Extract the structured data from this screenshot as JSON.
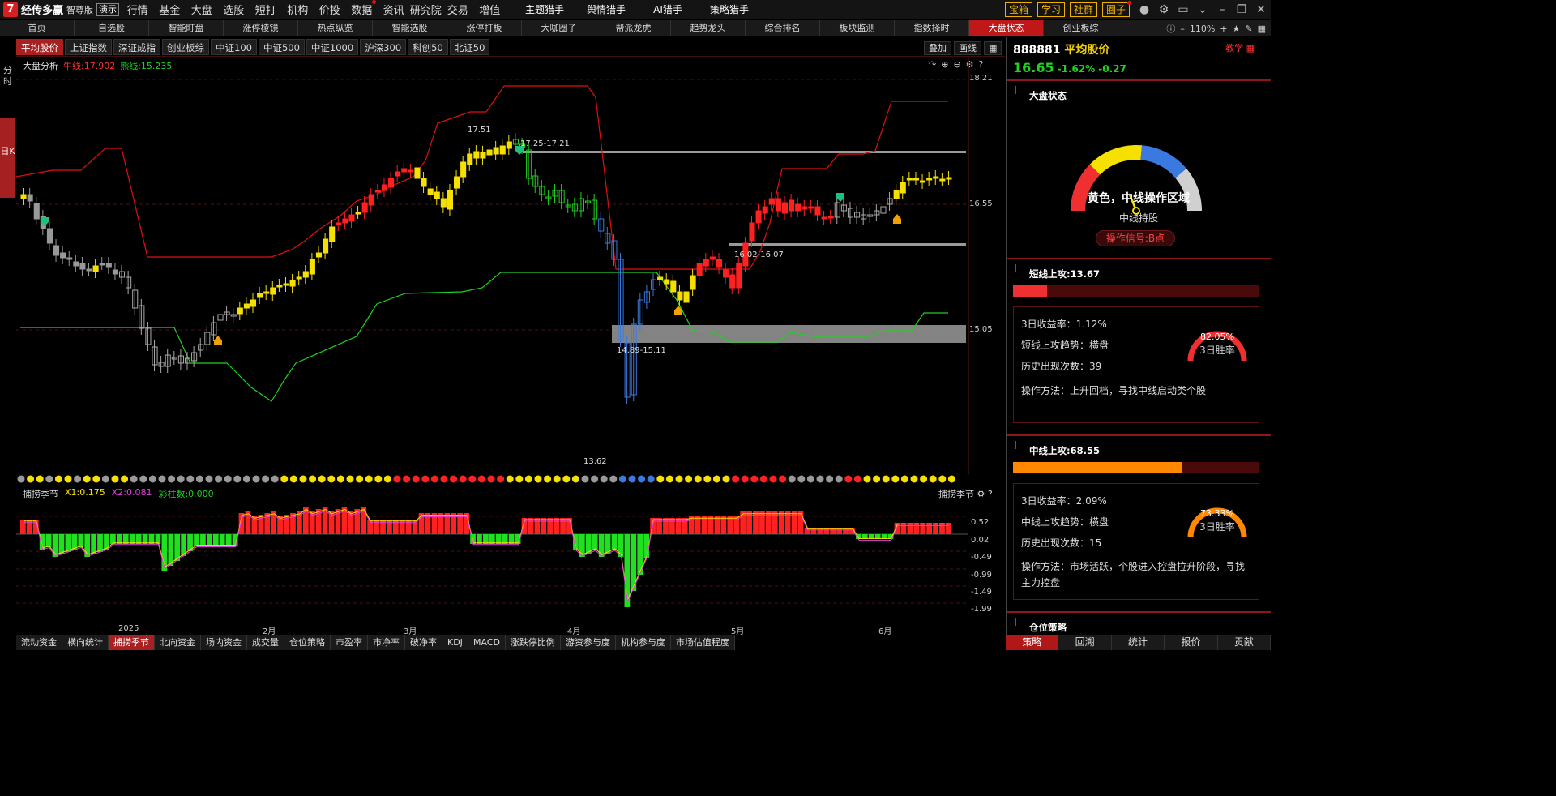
{
  "app": {
    "logo_mark": "7",
    "name": "经传多赢",
    "edition": "智尊版",
    "demo": "演示"
  },
  "main_menu": [
    "行情",
    "基金",
    "大盘",
    "选股",
    "短打",
    "机构",
    "价投",
    "数据",
    "资讯",
    "研究院",
    "交易",
    "增值"
  ],
  "main_menu_dot_index": 7,
  "hunt_menu": [
    "主题猎手",
    "舆情猎手",
    "AI猎手",
    "策略猎手"
  ],
  "top_buttons": [
    "宝箱",
    "学习",
    "社群",
    "圈子"
  ],
  "top_icons": [
    "user-icon",
    "gear-icon",
    "window-icon",
    "chevron-down-icon",
    "minimize-icon",
    "restore-icon",
    "close-icon"
  ],
  "nav": [
    "首页",
    "自选股",
    "智能盯盘",
    "涨停棱镜",
    "热点纵览",
    "智能选股",
    "涨停打板",
    "大咖圈子",
    "帮派龙虎",
    "趋势龙头",
    "综合排名",
    "板块监测",
    "指数择时",
    "大盘状态",
    "创业板综"
  ],
  "nav_active": 13,
  "nav_zoom": "110%",
  "rail": {
    "fenshi": "分时",
    "rik": "日K"
  },
  "index_tabs": [
    "平均股价",
    "上证指数",
    "深证成指",
    "创业板综",
    "中证100",
    "中证500",
    "中证1000",
    "沪深300",
    "科创50",
    "北证50"
  ],
  "index_active": 0,
  "chart_tools": [
    "叠加",
    "画线"
  ],
  "legend": {
    "title": "大盘分析",
    "bull": "牛线:17.902",
    "bear": "熊线:15.235"
  },
  "y_labels": [
    "18.21",
    "16.55",
    "15.05"
  ],
  "annotations": {
    "high": "17.51",
    "band1": "17.25-17.21",
    "band2": "16.02-16.07",
    "band3": "14.89-15.11",
    "low": "13.62"
  },
  "sub_legend": {
    "title": "捕捞季节",
    "x1": "X1:0.175",
    "x2": "X2:0.081",
    "c": "彩柱数:0.000",
    "right": "捕捞季节"
  },
  "sub_y": [
    "0.52",
    "0.02",
    "-0.49",
    "-0.99",
    "-1.49",
    "-1.99"
  ],
  "x_labels": [
    "2025",
    "2月",
    "3月",
    "4月",
    "5月",
    "6月"
  ],
  "bottom_tabs": [
    "流动资金",
    "横向统计",
    "捕捞季节",
    "北向资金",
    "场内资金",
    "成交量",
    "仓位策略",
    "市盈率",
    "市净率",
    "破净率",
    "KDJ",
    "MACD",
    "涨跌停比例",
    "游资参与度",
    "机构参与度",
    "市场估值程度"
  ],
  "bottom_active": 2,
  "right_panel": {
    "code": "888881",
    "name": "平均股价",
    "price": "16.65",
    "pct": "-1.62%",
    "chg": "-0.27",
    "teach": "教学",
    "state_title": "大盘状态",
    "state_main": "黄色，中线操作区域",
    "state_sub": "中线持股",
    "signal": "操作信号:B点",
    "short": {
      "title": "短线上攻:13.67",
      "fill": 0.1367,
      "ret": "3日收益率：1.12%",
      "trend": "短线上攻趋势：横盘",
      "count": "历史出现次数：39",
      "method": "操作方法：上升回档，寻找中线启动类个股",
      "win": "82.05%",
      "win_label": "3日胜率"
    },
    "mid": {
      "title": "中线上攻:68.55",
      "fill": 0.6855,
      "ret": "3日收益率：2.09%",
      "trend": "中线上攻趋势：横盘",
      "count": "历史出现次数：15",
      "method": "操作方法：市场活跃，个股进入控盘拉升阶段，寻找主力控盘",
      "win": "73.33%",
      "win_label": "3日胜率"
    },
    "pos_title": "仓位策略",
    "bottom": [
      "策略",
      "回溯",
      "统计",
      "报价",
      "贡献"
    ],
    "bottom_active": 0
  },
  "colors": {
    "accent": "#c01818",
    "bull": "#ff2020",
    "bear": "#20d020",
    "yellow": "#f5e000"
  }
}
